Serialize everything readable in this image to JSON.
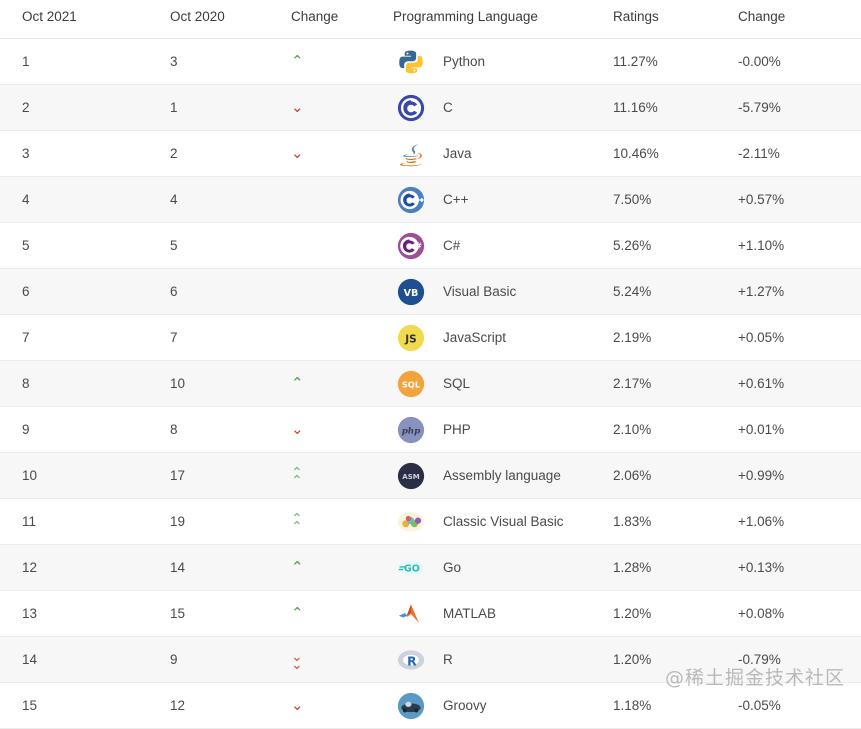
{
  "table": {
    "headers": {
      "rank_new": "Oct 2021",
      "rank_old": "Oct 2020",
      "change_rank": "Change",
      "language": "Programming Language",
      "ratings": "Ratings",
      "change_rating": "Change"
    },
    "rows": [
      {
        "rank_new": "1",
        "rank_old": "3",
        "change": "up",
        "logo": "python-logo",
        "language": "Python",
        "ratings": "11.27%",
        "change_rating": "-0.00%"
      },
      {
        "rank_new": "2",
        "rank_old": "1",
        "change": "down",
        "logo": "c-logo",
        "language": "C",
        "ratings": "11.16%",
        "change_rating": "-5.79%"
      },
      {
        "rank_new": "3",
        "rank_old": "2",
        "change": "down",
        "logo": "java-logo",
        "language": "Java",
        "ratings": "10.46%",
        "change_rating": "-2.11%"
      },
      {
        "rank_new": "4",
        "rank_old": "4",
        "change": "none",
        "logo": "cplusplus-logo",
        "language": "C++",
        "ratings": "7.50%",
        "change_rating": "+0.57%"
      },
      {
        "rank_new": "5",
        "rank_old": "5",
        "change": "none",
        "logo": "csharp-logo",
        "language": "C#",
        "ratings": "5.26%",
        "change_rating": "+1.10%"
      },
      {
        "rank_new": "6",
        "rank_old": "6",
        "change": "none",
        "logo": "visualbasic-logo",
        "language": "Visual Basic",
        "ratings": "5.24%",
        "change_rating": "+1.27%"
      },
      {
        "rank_new": "7",
        "rank_old": "7",
        "change": "none",
        "logo": "javascript-logo",
        "language": "JavaScript",
        "ratings": "2.19%",
        "change_rating": "+0.05%"
      },
      {
        "rank_new": "8",
        "rank_old": "10",
        "change": "up",
        "logo": "sql-logo",
        "language": "SQL",
        "ratings": "2.17%",
        "change_rating": "+0.61%"
      },
      {
        "rank_new": "9",
        "rank_old": "8",
        "change": "down",
        "logo": "php-logo",
        "language": "PHP",
        "ratings": "2.10%",
        "change_rating": "+0.01%"
      },
      {
        "rank_new": "10",
        "rank_old": "17",
        "change": "upup",
        "logo": "assembly-logo",
        "language": "Assembly language",
        "ratings": "2.06%",
        "change_rating": "+0.99%"
      },
      {
        "rank_new": "11",
        "rank_old": "19",
        "change": "upup",
        "logo": "classicvb-logo",
        "language": "Classic Visual Basic",
        "ratings": "1.83%",
        "change_rating": "+1.06%"
      },
      {
        "rank_new": "12",
        "rank_old": "14",
        "change": "up",
        "logo": "go-logo",
        "language": "Go",
        "ratings": "1.28%",
        "change_rating": "+0.13%"
      },
      {
        "rank_new": "13",
        "rank_old": "15",
        "change": "up",
        "logo": "matlab-logo",
        "language": "MATLAB",
        "ratings": "1.20%",
        "change_rating": "+0.08%"
      },
      {
        "rank_new": "14",
        "rank_old": "9",
        "change": "downdn",
        "logo": "r-logo",
        "language": "R",
        "ratings": "1.20%",
        "change_rating": "-0.79%"
      },
      {
        "rank_new": "15",
        "rank_old": "12",
        "change": "down",
        "logo": "groovy-logo",
        "language": "Groovy",
        "ratings": "1.18%",
        "change_rating": "-0.05%"
      }
    ]
  },
  "watermark": {
    "text": "@稀土掘金技术社区"
  },
  "colors": {
    "up": "#4ea24e",
    "down": "#cc4125",
    "up_double": "#6fbf6f",
    "down_double": "#d2572f",
    "row_alt_background": "#f7f7f7",
    "text": "#4a4a4a",
    "border": "#ececec"
  }
}
